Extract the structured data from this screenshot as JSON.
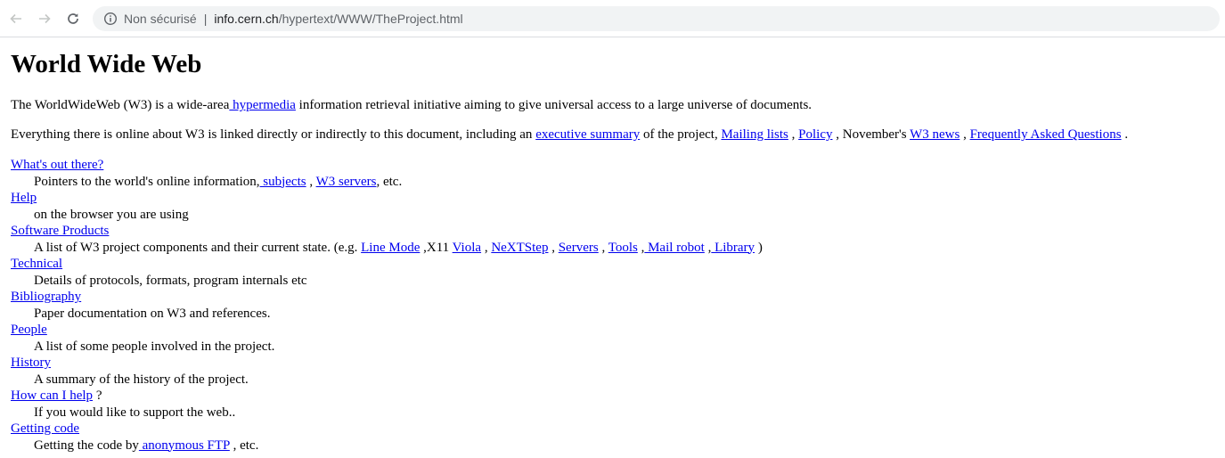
{
  "browser": {
    "security_label": "Non sécurisé",
    "separator": "|",
    "url_host": "info.cern.ch",
    "url_path": "/hypertext/WWW/TheProject.html"
  },
  "page": {
    "title": "World Wide Web",
    "intro": {
      "before": "The WorldWideWeb (W3) is a wide-area",
      "link": " hypermedia",
      "after": " information retrieval initiative aiming to give universal access to a large universe of documents."
    },
    "summary": {
      "t1": "Everything there is online about W3 is linked directly or indirectly to this document, including an ",
      "link1": "executive summary",
      "t2": " of the project, ",
      "link2": "Mailing lists",
      "t3": " , ",
      "link3": "Policy",
      "t4": " , November's ",
      "link4": "W3 news",
      "t5": " , ",
      "link5": "Frequently Asked Questions",
      "t6": " ."
    },
    "entries": {
      "whats_out": {
        "term": "What's out there?",
        "d1": "Pointers to the world's online information,",
        "l1": " subjects",
        "d2": " , ",
        "l2": "W3 servers",
        "d3": ", etc."
      },
      "help": {
        "term": "Help",
        "desc": "on the browser you are using"
      },
      "software": {
        "term": "Software Products",
        "d1": "A list of W3 project components and their current state. (e.g. ",
        "l1": "Line Mode",
        "d2": " ,X11 ",
        "l2": "Viola",
        "d3": " , ",
        "l3": "NeXTStep",
        "d4": " , ",
        "l4": "Servers",
        "d5": " , ",
        "l5": "Tools",
        "d6": " ,",
        "l6": " Mail robot",
        "d7": " ,",
        "l7": " Library",
        "d8": " )"
      },
      "technical": {
        "term": "Technical",
        "desc": "Details of protocols, formats, program internals etc"
      },
      "bibliography": {
        "term": "Bibliography",
        "desc": "Paper documentation on W3 and references."
      },
      "people": {
        "term": "People",
        "desc": "A list of some people involved in the project."
      },
      "history": {
        "term": "History",
        "desc": "A summary of the history of the project."
      },
      "how_help": {
        "term": "How can I help",
        "after": " ?",
        "desc": "If you would like to support the web.."
      },
      "getting_code": {
        "term": "Getting code",
        "d1": "Getting the code by",
        "l1": " anonymous FTP",
        "d2": " , etc."
      }
    }
  }
}
